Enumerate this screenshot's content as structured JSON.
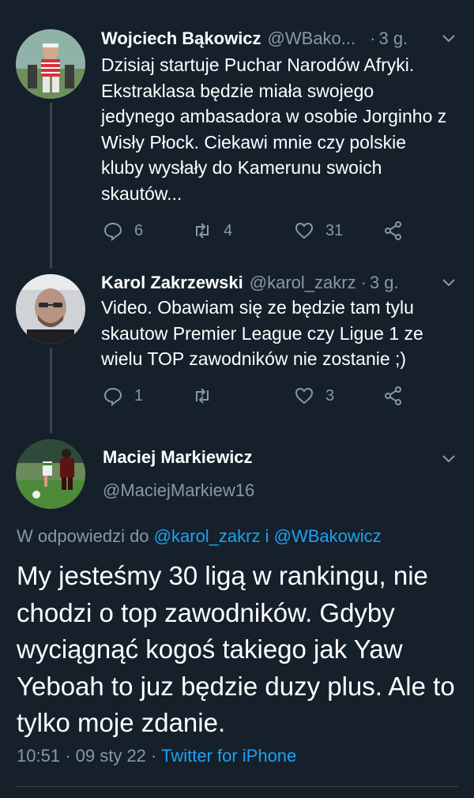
{
  "tweets": [
    {
      "author_name": "Wojciech Bąkowicz",
      "author_handle": "@WBako...",
      "time": "3 g.",
      "text": "Dzisiaj startuje Puchar Narodów Afryki. Ekstraklasa będzie miała swojego jedynego ambasadora w osobie Jorginho z Wisły Płock. Ciekawi mnie czy polskie kluby wysłały do Kamerunu swoich skautów...",
      "replies": "6",
      "retweets": "4",
      "likes": "31"
    },
    {
      "author_name": "Karol Zakrzewski",
      "author_handle": "@karol_zakrz",
      "time": "3 g.",
      "text": "Video. Obawiam się ze będzie tam tylu skautow Premier League czy Ligue 1 ze wielu TOP zawodników nie zostanie ;)",
      "replies": "1",
      "retweets": "",
      "likes": "3"
    }
  ],
  "main_tweet": {
    "author_name": "Maciej Markiewicz",
    "author_handle": "@MaciejMarkiew16",
    "reply_prefix": "W odpowiedzi do",
    "reply_user_1": "@karol_zakrz",
    "reply_conjunction": "i",
    "reply_user_2": "@WBakowicz",
    "text": "My jesteśmy 30 ligą w rankingu, nie chodzi o top zawodników. Gdyby wyciągnąć kogoś takiego jak Yaw Yeboah to juz będzie duzy plus. Ale to tylko moje zdanie.",
    "time": "10:51",
    "date": "09 sty 22",
    "source": "Twitter for iPhone"
  },
  "colors": {
    "background": "#15202b",
    "secondary_text": "#8899a6",
    "accent": "#1da1f2"
  },
  "icons": [
    "reply-icon",
    "retweet-icon",
    "like-icon",
    "share-icon",
    "chevron-down-icon"
  ]
}
